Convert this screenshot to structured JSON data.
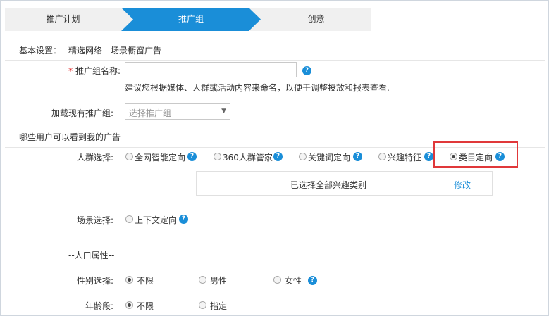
{
  "steps": [
    "推广计划",
    "推广组",
    "创意"
  ],
  "basic": {
    "label": "基本设置：",
    "value": "精选网络 - 场景橱窗广告"
  },
  "group_name": {
    "required_mark": "*",
    "label": "推广组名称:",
    "value": "",
    "hint": "建议您根据媒体、人群或活动内容来命名，以便于调整投放和报表查看."
  },
  "load_group": {
    "label": "加载现有推广组:",
    "placeholder": "选择推广组"
  },
  "audience_section": "哪些用户可以看到我的广告",
  "crowd": {
    "label": "人群选择:",
    "options": [
      "全网智能定向",
      "360人群管家",
      "关键词定向",
      "兴趣特征",
      "类目定向"
    ],
    "selected": "类目定向",
    "summary": "已选择全部兴趣类别",
    "edit_link": "修改"
  },
  "scene": {
    "label": "场景选择:",
    "option": "上下文定向"
  },
  "demographics_heading": "--人口属性--",
  "gender": {
    "label": "性别选择:",
    "options": [
      "不限",
      "男性",
      "女性"
    ],
    "selected": "不限"
  },
  "age": {
    "label": "年龄段:",
    "options": [
      "不限",
      "指定"
    ],
    "selected": "不限"
  },
  "help_glyph": "?",
  "colors": {
    "accent": "#1a8ed8",
    "step_active": "#1a8ed8",
    "highlight": "#e0383a"
  }
}
